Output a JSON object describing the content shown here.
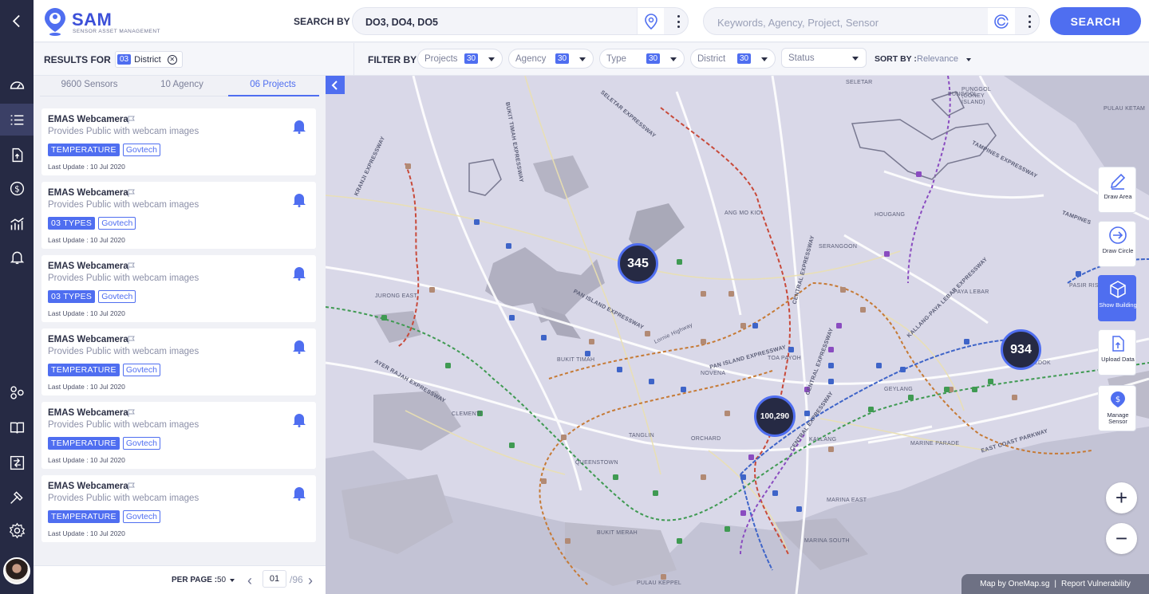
{
  "header": {
    "app_name": "SAM",
    "app_subtitle": "SENSOR ASSET MANAGEMENT",
    "search_by_label": "SEARCH BY",
    "location_value": "DO3, DO4, DO5",
    "keyword_placeholder": "Keywords, Agency, Project, Sensor",
    "search_button": "SEARCH"
  },
  "results": {
    "label": "RESULTS FOR",
    "chip_count": "03",
    "chip_label": "District"
  },
  "filters": {
    "label": "FILTER BY",
    "items": [
      {
        "label": "Projects",
        "count": "30"
      },
      {
        "label": "Agency",
        "count": "30"
      },
      {
        "label": "Type",
        "count": "30"
      },
      {
        "label": "District",
        "count": "30"
      },
      {
        "label": "Status",
        "count": ""
      }
    ],
    "sort_label": "SORT BY :",
    "sort_value": "Relevance"
  },
  "tabs": [
    {
      "label": "9600 Sensors"
    },
    {
      "label": "10 Agency"
    },
    {
      "label": "06 Projects"
    }
  ],
  "cards": [
    {
      "title": "EMAS Webcamera",
      "desc": "Provides Public with webcam images",
      "tag": "TEMPERATURE",
      "agency": "Govtech",
      "updated": "Last Update : 10 Jul 2020"
    },
    {
      "title": "EMAS Webcamera",
      "desc": "Provides Public with webcam images",
      "tag": "03  TYPES",
      "agency": "Govtech",
      "updated": "Last Update : 10 Jul 2020"
    },
    {
      "title": "EMAS Webcamera",
      "desc": "Provides Public with webcam images",
      "tag": "03  TYPES",
      "agency": "Govtech",
      "updated": "Last Update : 10 Jul 2020"
    },
    {
      "title": "EMAS Webcamera",
      "desc": "Provides Public with webcam images",
      "tag": "TEMPERATURE",
      "agency": "Govtech",
      "updated": "Last Update : 10 Jul 2020"
    },
    {
      "title": "EMAS Webcamera",
      "desc": "Provides Public with webcam images",
      "tag": "TEMPERATURE",
      "agency": "Govtech",
      "updated": "Last Update : 10 Jul 2020"
    },
    {
      "title": "EMAS Webcamera",
      "desc": "Provides Public with webcam images",
      "tag": "TEMPERATURE",
      "agency": "Govtech",
      "updated": "Last Update : 10 Jul 2020"
    }
  ],
  "pager": {
    "per_page_label": "PER PAGE :",
    "per_page_value": "50",
    "page": "01",
    "total": "/96"
  },
  "map": {
    "clusters": [
      "345",
      "934",
      "100,290"
    ],
    "labels": [
      "SELETAR",
      "PUNGGOL",
      "PUNGGOL (CONEY ISLAND)",
      "PULAU KETAM",
      "TAMPINES EXPRESSWAY",
      "TAMPINES",
      "HOUGANG",
      "ANG MO KIO",
      "SERANGOON",
      "PAYA LEBAR",
      "PASIR RIS",
      "JURONG EAST",
      "BUKIT TIMAH",
      "TOA PAYOH",
      "NOVENA",
      "GEYLANG",
      "BEDOK",
      "CLEMENTI",
      "TANGLIN",
      "ORCHARD",
      "KALLANG",
      "MARINE PARADE",
      "QUEENSTOWN",
      "MARINA EAST",
      "MARINA SOUTH",
      "BUKIT MERAH",
      "PULAU KEPPEL",
      "BUKIT TIMAH EXPRESSWAY",
      "SELETAR EXPRESSWAY",
      "KRANJI EXPRESSWAY",
      "PAN ISLAND EXPRESSWAY",
      "PAN ISLAND EXPRESSWAY",
      "CENTRAL EXPRESSWAY",
      "CENTRAL EXPRESSWAY",
      "CENTRAL EXPRESSWAY",
      "KALLANG-PAYA LEBAR EXPRESSWAY",
      "AYER RAJAH EXPRESSWAY",
      "EAST COAST PARKWAY",
      "Lornie Highway"
    ],
    "tools": [
      "Draw Area",
      "Draw Circle",
      "Show Building",
      "Upload Data",
      "Manage Sensor"
    ],
    "attribution": "Map by OneMap.sg",
    "report": "Report Vulnerability"
  },
  "colors": {
    "accent": "#4f6ef0",
    "rail": "#262a44",
    "map_bg": "#d9d8e8"
  }
}
